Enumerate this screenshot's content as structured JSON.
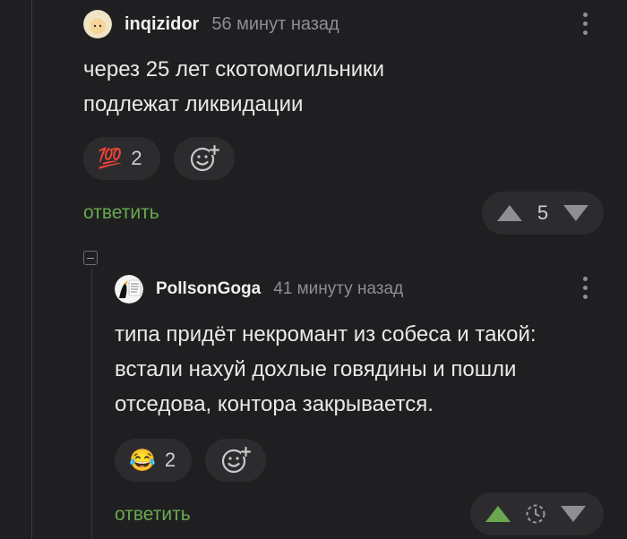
{
  "comments": [
    {
      "username": "inqizidor",
      "time": "56 минут назад",
      "text_lines": [
        "через 25 лет скотомогильники",
        "подлежат ликвидации"
      ],
      "reaction": {
        "emoji": "💯",
        "count": "2"
      },
      "reply_label": "ответить",
      "votes": "5"
    },
    {
      "username": "PollsonGoga",
      "time": "41 минуту назад",
      "text_lines": [
        "типа придёт некромант из собеса и такой:",
        "встали нахуй дохлые говядины и пошли",
        "отседова, контора закрывается."
      ],
      "reaction": {
        "emoji": "😂",
        "count": "2"
      },
      "reply_label": "ответить",
      "votes": ""
    }
  ],
  "icons": {
    "add_reaction": "smiley-plus-icon",
    "upvote": "triangle-up-icon",
    "downvote": "triangle-down-icon",
    "pending": "clock-dashed-icon",
    "menu": "kebab-menu-icon"
  },
  "colors": {
    "background": "#1f1f21",
    "reply": "#6aa84f",
    "upvote_active": "#6aa84f",
    "muted": "#8e8e93"
  }
}
